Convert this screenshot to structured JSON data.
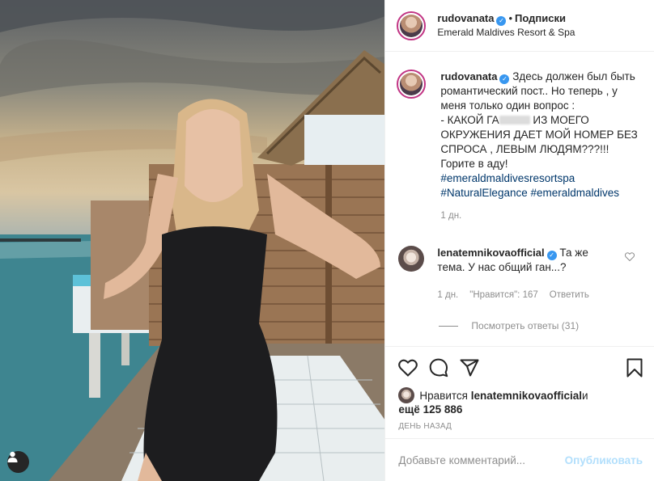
{
  "header": {
    "username": "rudovanata",
    "separator": "•",
    "follow_label": "Подписки",
    "location": "Emerald Maldives Resort & Spa"
  },
  "caption": {
    "username": "rudovanata",
    "text_1": "Здесь должен был быть романтический пост.. Но теперь , у меня только один вопрос :",
    "text_2a": "- КАКОЙ ГА",
    "text_2b": " ИЗ МОЕГО ОКРУЖЕНИЯ ДАЕТ МОЙ НОМЕР БЕЗ СПРОСА , ЛЕВЫМ ЛЮДЯМ???!!!",
    "text_3": "Горите в аду!",
    "hashtags": [
      "#emeraldmaldivesresortspa",
      "#NaturalElegance",
      "#emeraldmaldives"
    ],
    "time": "1 дн."
  },
  "reply": {
    "username": "lenatemnikovaofficial",
    "text": "Та же тема. У нас общий ган...?",
    "time": "1 дн.",
    "likes": "\"Нравится\": 167",
    "reply_label": "Ответить",
    "view_replies": "Посмотреть ответы (31)"
  },
  "likes": {
    "prefix": "Нравится ",
    "user": "lenatemnikovaofficial",
    "suffix": " и",
    "others": "ещё 125 886"
  },
  "posted_ago": "ДЕНЬ НАЗАД",
  "comment_box": {
    "placeholder": "Добавьте комментарий...",
    "publish": "Опубликовать"
  },
  "icons": [
    "user-tag-icon",
    "heart-icon",
    "comment-icon",
    "share-icon",
    "bookmark-icon",
    "verified-icon"
  ],
  "colors": {
    "link": "#00376b",
    "muted": "#8e8e8e",
    "verified": "#3897f0",
    "publish_disabled": "#b2dffc"
  }
}
